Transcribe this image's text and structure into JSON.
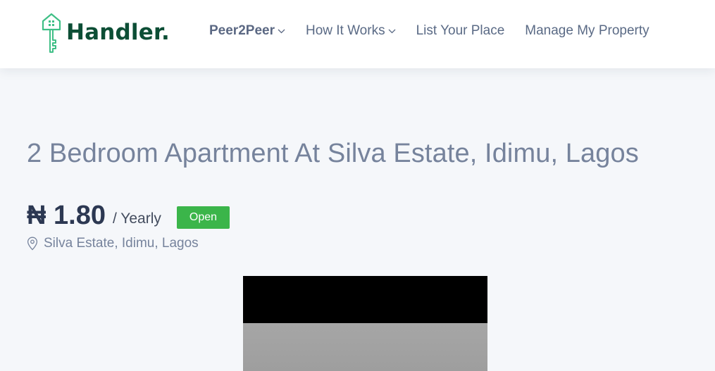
{
  "brand": {
    "name": "Handler.",
    "color": "#0c4e35",
    "accent": "#3fbf86"
  },
  "nav": {
    "items": [
      {
        "label": "Peer2Peer",
        "has_dropdown": true
      },
      {
        "label": "How It Works",
        "has_dropdown": true
      },
      {
        "label": "List Your Place",
        "has_dropdown": false
      },
      {
        "label": "Manage My Property",
        "has_dropdown": false
      }
    ]
  },
  "listing": {
    "title": "2 Bedroom Apartment At Silva Estate, Idimu, Lagos",
    "price": "₦ 1.80",
    "period": "/ Yearly",
    "status": "Open",
    "status_color": "#3bb54a",
    "location": "Silva Estate, Idimu, Lagos",
    "location_icon": "map-pin-icon"
  }
}
